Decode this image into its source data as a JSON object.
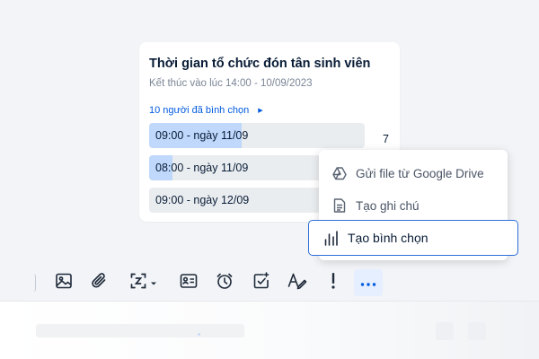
{
  "poll": {
    "title": "Thời gian tổ chức đón tân sinh viên",
    "deadline": "Kết thúc vào lúc 14:00 - 10/09/2023",
    "voters": "10 người đã bình chọn",
    "options": [
      {
        "label": "09:00 - ngày 11/09",
        "count": "7",
        "fill_percent": 43
      },
      {
        "label": "08:00 - ngày 11/09",
        "count": "",
        "fill_percent": 11
      },
      {
        "label": "09:00 - ngày 12/09",
        "count": "",
        "fill_percent": 0
      }
    ]
  },
  "menu": {
    "items": [
      {
        "label": "Gửi file từ Google Drive",
        "icon": "google-drive-icon"
      },
      {
        "label": "Tạo ghi chú",
        "icon": "note-icon"
      },
      {
        "label": "Tạo bình chọn",
        "icon": "poll-icon",
        "selected": true
      }
    ]
  },
  "toolbar": {
    "buttons": [
      {
        "icon": "image-icon"
      },
      {
        "icon": "attachment-icon"
      },
      {
        "icon": "screenshot-icon"
      },
      {
        "icon": "contact-card-icon"
      },
      {
        "icon": "alarm-icon"
      },
      {
        "icon": "task-icon"
      },
      {
        "icon": "text-format-icon"
      },
      {
        "icon": "urgent-icon"
      },
      {
        "icon": "more-icon",
        "active": true
      }
    ]
  },
  "colors": {
    "accent": "#005ae0",
    "vote_fill": "#bfd8fb",
    "option_bg": "#eaedf0",
    "menu_selected_border": "#2d6fd8",
    "icon": "#1f2a3a"
  }
}
